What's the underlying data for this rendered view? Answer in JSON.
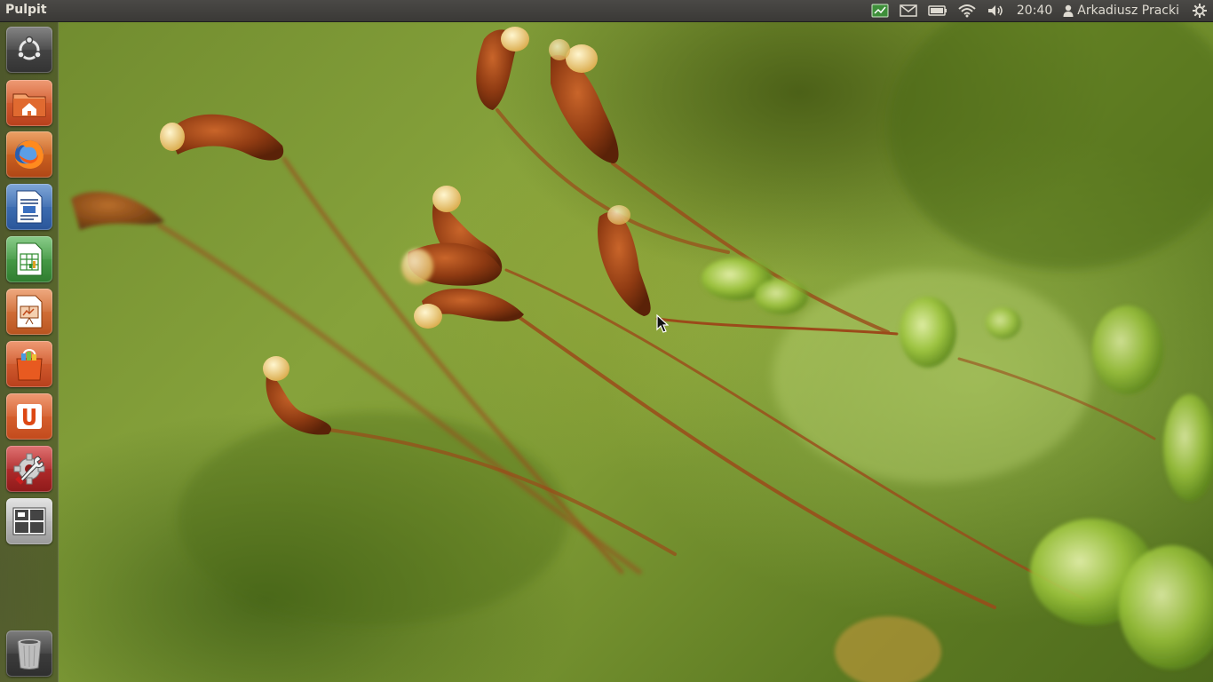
{
  "panel": {
    "app_title": "Pulpit",
    "clock": "20:40",
    "user_name": "Arkadiusz Pracki",
    "indicators": [
      "network-monitor-icon",
      "mail-icon",
      "battery-icon",
      "wifi-icon",
      "volume-icon"
    ]
  },
  "launcher": {
    "items": [
      {
        "name": "dash-home",
        "icon": "ubuntu-logo-icon"
      },
      {
        "name": "home-folder",
        "icon": "home-folder-icon"
      },
      {
        "name": "firefox",
        "icon": "firefox-icon"
      },
      {
        "name": "libreoffice-writer",
        "icon": "writer-icon"
      },
      {
        "name": "libreoffice-calc",
        "icon": "calc-icon"
      },
      {
        "name": "libreoffice-impress",
        "icon": "impress-icon"
      },
      {
        "name": "software-center",
        "icon": "shopping-bag-icon"
      },
      {
        "name": "ubuntu-one",
        "icon": "ubuntu-one-icon"
      },
      {
        "name": "system-settings",
        "icon": "settings-wrench-icon"
      },
      {
        "name": "workspace-switcher",
        "icon": "workspaces-icon"
      },
      {
        "name": "trash",
        "icon": "trash-icon"
      }
    ]
  },
  "colors": {
    "panel_bg": "#3c3b37",
    "accent_orange": "#dd4814",
    "wallpaper_green": "#7e9a34",
    "moss_brown": "#8a3a14"
  }
}
